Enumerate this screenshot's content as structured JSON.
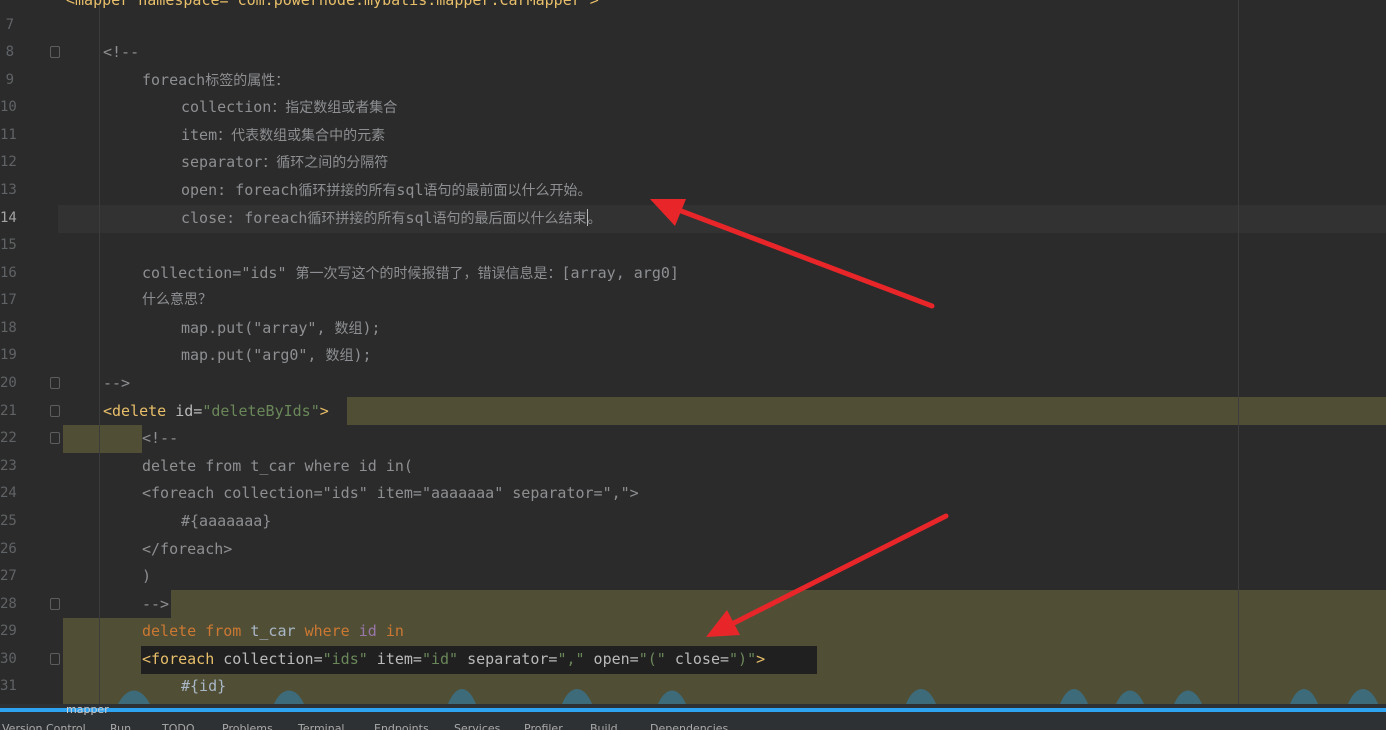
{
  "editor": {
    "top_partial_line": "<mapper namespace=\"com.powernode.mybatis.mapper.CarMapper\">",
    "line_numbers": [
      "7",
      "8",
      "9",
      "10",
      "11",
      "12",
      "13",
      "14",
      "15",
      "16",
      "17",
      "18",
      "19",
      "20",
      "21",
      "22",
      "23",
      "24",
      "25",
      "26",
      "27",
      "28",
      "29",
      "30",
      "31"
    ],
    "current_line": "14",
    "comment_open": "<!--",
    "comment_close": "-->",
    "foreach_attr_title_code": "foreach",
    "foreach_attr_title_cjk": "标签的属性：",
    "collection_key": "collection",
    "collection_desc": "：指定数组或者集合",
    "item_key": "item",
    "item_desc": "：代表数组或集合中的元素",
    "separator_key": "separator",
    "separator_desc": "：循环之间的分隔符",
    "open_key": "open: foreach",
    "open_desc_1": "循环拼接的所有",
    "open_sql": "sql",
    "open_desc_2": "语句的最前面以什么开始。",
    "close_key": "close: foreach",
    "close_desc_1": "循环拼接的所有",
    "close_sql": "sql",
    "close_desc_2a": "语句的最后面以什么结束",
    "close_desc_2b": "。",
    "err_code_1": "collection=\"ids\" ",
    "err_desc": "第一次写这个的时候报错了，错误信息是：",
    "err_code_2": "[array, arg0]",
    "meaning": "什么意思？",
    "map_put_array": "map.put(\"array\", ",
    "map_put_arg0": "map.put(\"arg0\", ",
    "array_word": "数组",
    "map_put_end": ");",
    "delete_open": "<delete",
    "id_attr": " id=",
    "id_value": "\"deleteByIds\"",
    "gt": ">",
    "inner_comment_open": "<!--",
    "old_delete": "delete from t_car where id in(",
    "old_foreach": "<foreach collection=\"ids\" item=\"aaaaaaa\" separator=\",\">",
    "old_item": "#{aaaaaaa}",
    "old_foreach_end": "</foreach>",
    "old_paren": ")",
    "inner_comment_close": "-->",
    "sql_delete": "delete",
    "sql_from": "from",
    "sql_table": "t_car",
    "sql_where": "where",
    "sql_id": "id",
    "sql_in": "in",
    "foreach_tag": "<foreach",
    "fe_collection": " collection=",
    "fe_collection_val": "\"ids\"",
    "fe_item": " item=",
    "fe_item_val": "\"id\"",
    "fe_separator": " separator=",
    "fe_separator_val": "\",\"",
    "fe_open": " open=",
    "fe_open_val": "\"(\"",
    "fe_close": " close=",
    "fe_close_val": "\")\"",
    "fe_gt": ">",
    "item_expr": "#{id}"
  },
  "breadcrumb": {
    "label": "mapper"
  },
  "status_bar": {
    "items": [
      "Version Control",
      "Run",
      "TODO",
      "Problems",
      "Terminal",
      "Endpoints",
      "Services",
      "Profiler",
      "Build",
      "Dependencies"
    ]
  },
  "colors": {
    "background": "#2b2b2b",
    "annotation_arrow": "#e8262a",
    "selection_highlight": "#504f36",
    "progress_line": "#2ea3f2"
  }
}
